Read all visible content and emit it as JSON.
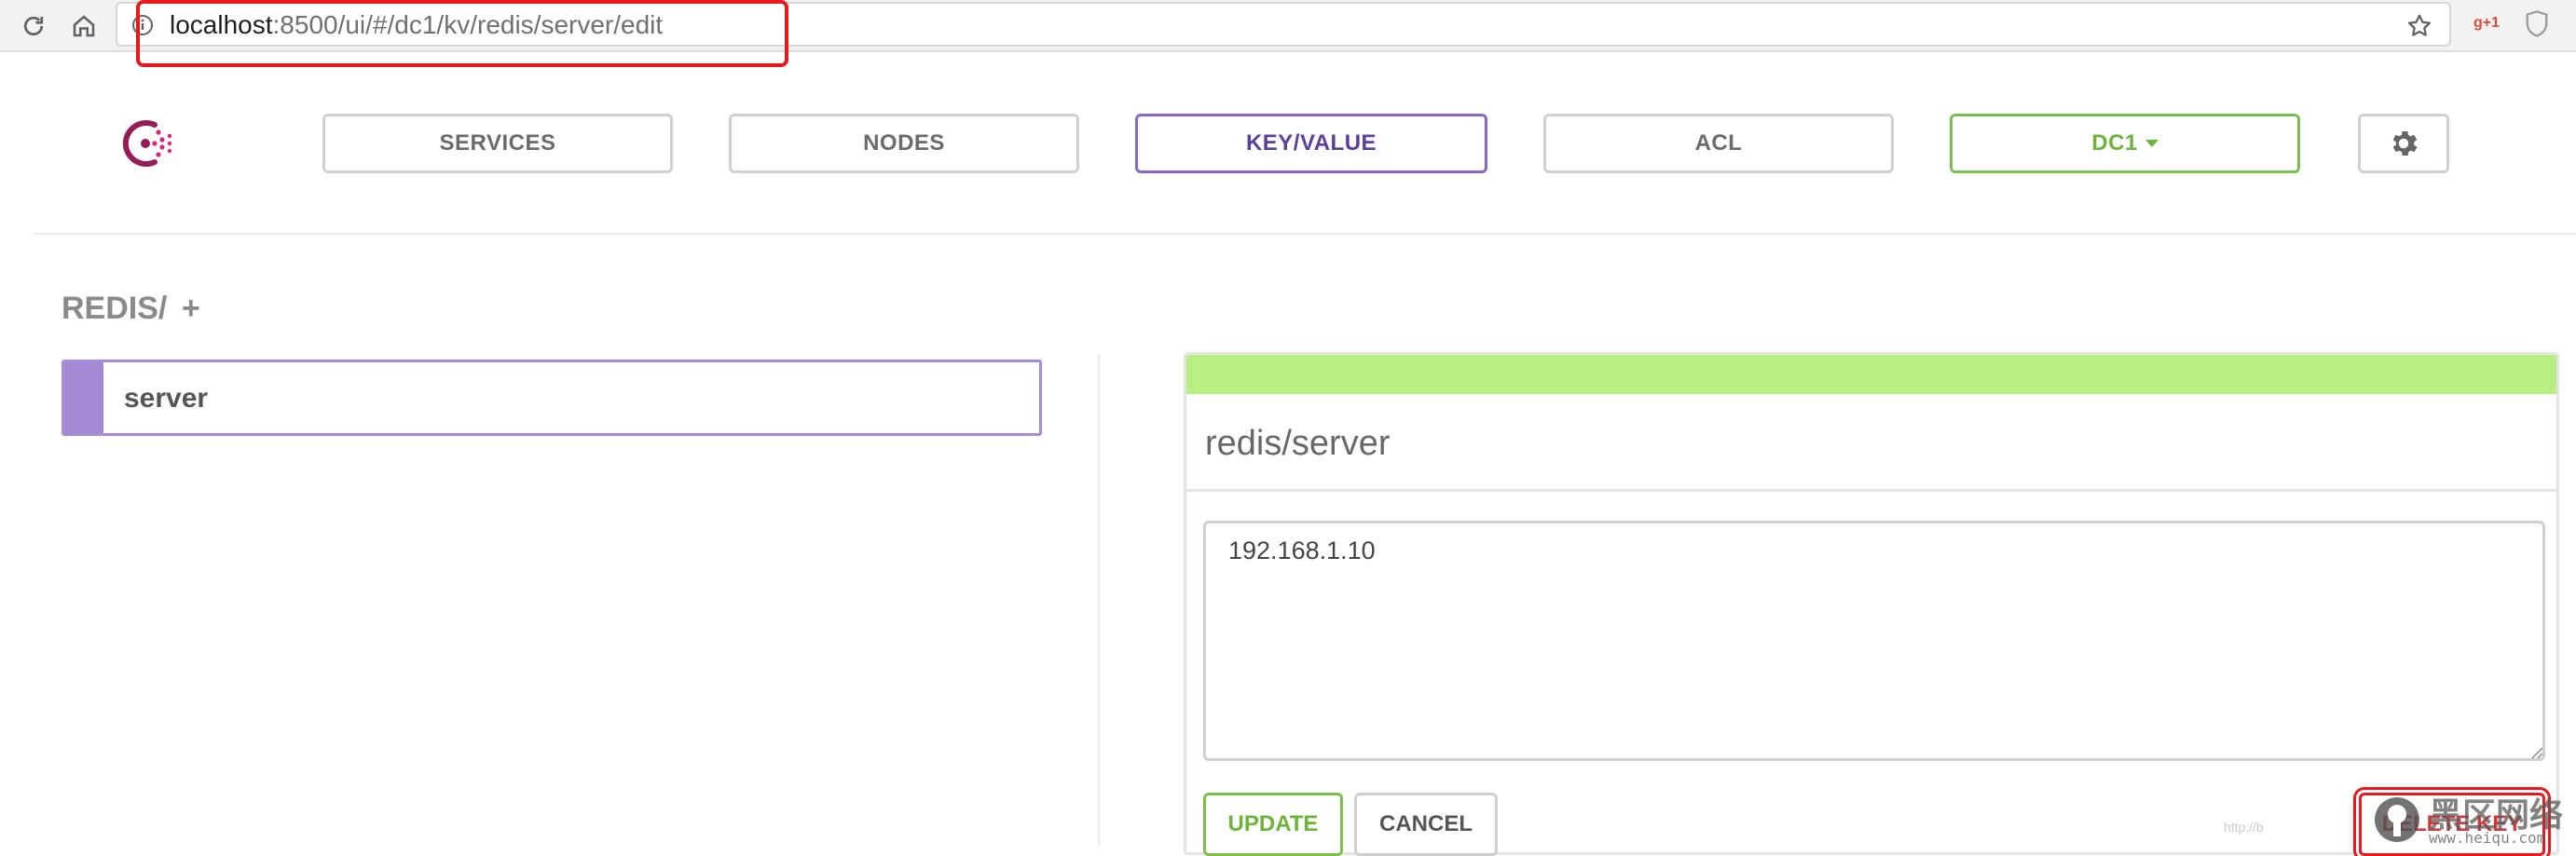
{
  "browser": {
    "url_host": "localhost",
    "url_rest": ":8500/ui/#/dc1/kv/redis/server/edit",
    "extension_gplus": "g+1"
  },
  "nav": {
    "services": "SERVICES",
    "nodes": "NODES",
    "keyvalue": "KEY/VALUE",
    "acl": "ACL",
    "datacenter": "DC1"
  },
  "kv": {
    "folder_title": "REDIS/",
    "add_symbol": "+",
    "items": [
      {
        "label": "server"
      }
    ]
  },
  "editor": {
    "key_path": "redis/server",
    "value": "192.168.1.10",
    "update_label": "UPDATE",
    "cancel_label": "CANCEL",
    "delete_label": "DELETE KEY"
  },
  "watermark": {
    "text_cn": "黑区网络",
    "url": "www.heiqu.com",
    "faint": "http://b"
  },
  "colors": {
    "accent_purple": "#8966c7",
    "accent_green": "#7cbf4c",
    "status_bar_green": "#b8ef83",
    "highlight_red": "#e8191b"
  }
}
